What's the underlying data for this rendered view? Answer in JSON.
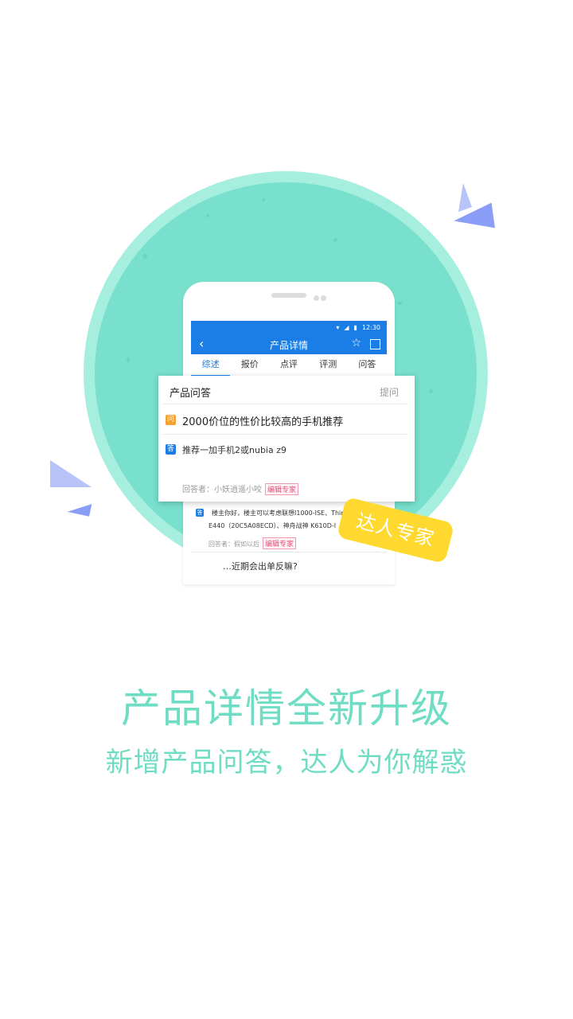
{
  "status_bar": {
    "time": "12:30",
    "icons": [
      "wifi-icon",
      "signal-icon",
      "battery-icon"
    ]
  },
  "nav": {
    "title": "产品详情",
    "back_icon": "back-arrow-icon",
    "star_icon": "star-icon",
    "share_icon": "share-icon"
  },
  "tabs": [
    {
      "label": "综述",
      "active": true
    },
    {
      "label": "报价",
      "active": false
    },
    {
      "label": "点评",
      "active": false
    },
    {
      "label": "评测",
      "active": false
    },
    {
      "label": "问答",
      "active": false
    }
  ],
  "card": {
    "title": "产品问答",
    "ask_label": "提问",
    "question_badge": "问",
    "question": "2000价位的性价比较高的手机推荐",
    "answer_badge": "答",
    "answer": "推荐一加手机2或nubia z9",
    "answerer_label": "回答者：小妖逍遥小咬",
    "answerer_tag": "编辑专家"
  },
  "behind_card": {
    "answer_badge": "答",
    "answer_line1": "楼主你好，楼主可以考虑联想I1000-ISE、ThinkPad",
    "answer_line2": "E440（20C5A08ECD）、神舟战神 K610D-I",
    "answerer_label": "回答者：假如以后",
    "answerer_tag": "编辑专家",
    "next_question": "…近期会出单反嘛?"
  },
  "expert_badge": "达人专家",
  "headline": "产品详情全新升级",
  "subheadline": "新增产品问答，达人为你解惑",
  "colors": {
    "accent": "#1b7de6",
    "mint": "#78e0cd",
    "headline": "#6fdcc4",
    "badge_yellow": "#ffd92f",
    "triangle": "#8a9ef7"
  }
}
